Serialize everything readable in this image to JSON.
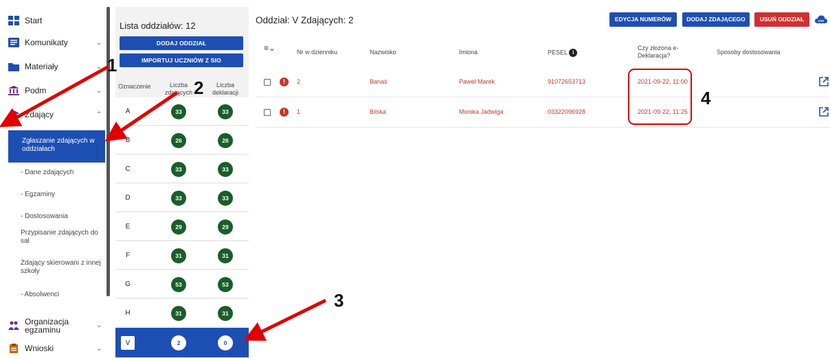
{
  "sidebar": {
    "items": [
      {
        "label": "Start",
        "icon": "grid-icon"
      },
      {
        "label": "Komunikaty",
        "icon": "message-icon"
      },
      {
        "label": "Materiały",
        "icon": "folder-icon"
      },
      {
        "label": "Podm",
        "icon": "building-icon"
      },
      {
        "label": "Zdający",
        "icon": "graduation-cap-icon"
      },
      {
        "label": "Organizacja egzaminu",
        "icon": "people-icon"
      },
      {
        "label": "Wnioski",
        "icon": "clipboard-icon"
      }
    ],
    "sub_items": [
      "Zgłaszanie zdających w oddziałach",
      "- Dane zdających",
      "- Egzaminy",
      "- Dostosowania",
      "Przypisanie zdających do sal",
      "Zdający skierowani z innej szkoły",
      "- Absolwenci"
    ],
    "sub_prefix": "-"
  },
  "class_panel": {
    "title": "Lista oddziałów: 12",
    "add_button": "DODAJ ODDZIAŁ",
    "import_button": "IMPORTUJ UCZNIÓW Z SIO",
    "headers": {
      "code": "Oznaczenie",
      "students": "Liczba zdających",
      "declarations": "Liczba deklaracji"
    },
    "rows": [
      {
        "code": "A",
        "students": "33",
        "declarations": "33"
      },
      {
        "code": "B",
        "students": "26",
        "declarations": "26"
      },
      {
        "code": "C",
        "students": "33",
        "declarations": "33"
      },
      {
        "code": "D",
        "students": "33",
        "declarations": "33"
      },
      {
        "code": "E",
        "students": "29",
        "declarations": "29"
      },
      {
        "code": "F",
        "students": "31",
        "declarations": "31"
      },
      {
        "code": "G",
        "students": "53",
        "declarations": "53"
      },
      {
        "code": "H",
        "students": "31",
        "declarations": "31"
      },
      {
        "code": "V",
        "students": "2",
        "declarations": "0",
        "selected": true
      }
    ]
  },
  "main": {
    "title": "Oddział: V Zdających: 2",
    "buttons": {
      "edit_numbers": "EDYCJA NUMERÓW",
      "add_student": "DODAJ ZDAJĄCEGO",
      "remove_class": "USUŃ ODDZIAŁ",
      "csv": "csv"
    },
    "columns": {
      "number": "Nr w dzienniku",
      "surname": "Nazwisko",
      "names": "Imiona",
      "pesel": "PESEL",
      "declaration": "Czy złożona e-Deklaracja?",
      "adjustments": "Sposoby dostosowania"
    },
    "rows": [
      {
        "number": "2",
        "surname": "Banaś",
        "names": "Paweł Marek",
        "pesel": "91072653713",
        "declaration": "2021-09-22, 11:00",
        "adjustments": ""
      },
      {
        "number": "1",
        "surname": "Bilska",
        "names": "Monika Jadwiga",
        "pesel": "03322096928",
        "declaration": "2021-09-22, 11:25",
        "adjustments": ""
      }
    ]
  },
  "annotations": [
    "1",
    "2",
    "3",
    "4"
  ],
  "colors": {
    "primary": "#1d4fb3",
    "danger": "#d32f2f",
    "badge": "#1a5e2a",
    "arrow": "#e00000"
  }
}
